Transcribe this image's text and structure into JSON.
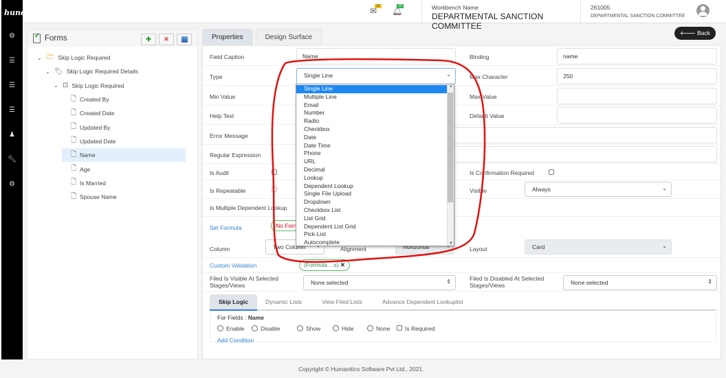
{
  "app": {
    "logo": "huno"
  },
  "sidebar": {
    "icons": [
      "cogs-icon",
      "database-icon",
      "database-icon",
      "database-icon",
      "users-icon",
      "wrench-icon",
      "cogs-icon"
    ]
  },
  "topbar": {
    "mail_count": "10",
    "notif_count": "10",
    "workbench_label": "Workbench Name",
    "workbench_name": "DEPARTMENTAL SANCTION COMMITTEE",
    "user_id": "261005",
    "user_dept": "DEPARTMENTAL SANCTION COMMITTEE"
  },
  "left_panel": {
    "title": "Forms",
    "tree": [
      {
        "label": "Skip Logic Required",
        "level": 0,
        "icon": "folder-open-icon",
        "expanded": true
      },
      {
        "label": "Skip Logic Required Details",
        "level": 1,
        "icon": "tag-icon",
        "expanded": true
      },
      {
        "label": "Skip Logic Required",
        "level": 2,
        "icon": "inbox-icon",
        "expanded": true
      },
      {
        "label": "Created By",
        "level": 3,
        "icon": "file-icon"
      },
      {
        "label": "Created Date",
        "level": 3,
        "icon": "file-icon"
      },
      {
        "label": "Updated By",
        "level": 3,
        "icon": "file-icon"
      },
      {
        "label": "Updated Date",
        "level": 3,
        "icon": "file-icon"
      },
      {
        "label": "Name",
        "level": 3,
        "icon": "file-icon",
        "selected": true
      },
      {
        "label": "Age",
        "level": 3,
        "icon": "file-icon"
      },
      {
        "label": "Is Married",
        "level": 3,
        "icon": "file-icon"
      },
      {
        "label": "Spouse Name",
        "level": 3,
        "icon": "file-icon"
      }
    ]
  },
  "main": {
    "tabs": [
      "Properties",
      "Design Surface"
    ],
    "back_label": "Back",
    "fields": {
      "field_caption": {
        "label": "Field Caption",
        "value": "Name"
      },
      "binding": {
        "label": "Binding",
        "value": "name"
      },
      "type": {
        "label": "Type",
        "value": "Single Line"
      },
      "max_character": {
        "label": "Max Character",
        "value": "250"
      },
      "min_value": {
        "label": "Min Value",
        "value": ""
      },
      "max_value": {
        "label": "Max Value",
        "value": ""
      },
      "help_text": {
        "label": "Help Text",
        "value": ""
      },
      "default_value": {
        "label": "Default Value",
        "value": ""
      },
      "error_message": {
        "label": "Error Message",
        "value": ""
      },
      "regular_expression": {
        "label": "Regular Expression",
        "value": ""
      },
      "is_audit": {
        "label": "Is Audit",
        "checked": false
      },
      "is_confirmation_required": {
        "label": "Is Confirmation Required",
        "checked": false
      },
      "is_repeatable": {
        "label": "Is Repeatable",
        "checked": false
      },
      "visible": {
        "label": "Visible",
        "value": "Always"
      },
      "is_multiple_dependent_lookup": {
        "label": "Is Multiple Dependent Lookup"
      },
      "set_formula": {
        "label": "Set Formula",
        "pill": "No Formula"
      },
      "column": {
        "label": "Column",
        "value": "Two Column"
      },
      "alignment": {
        "label": "Alignment",
        "value": "Horizontal"
      },
      "layout": {
        "label": "Layout",
        "value": "Card"
      },
      "custom_validation": {
        "label": "Custom Validation",
        "pill": "(Formula ...s)"
      },
      "visible_stages": {
        "label": "Filed Is Visible At Selected Stages/Views",
        "value": "None selected"
      },
      "disabled_stages": {
        "label": "Filed Is Disabled At Selected Stages/Views",
        "value": "None selected"
      }
    },
    "type_options": [
      "Single Line",
      "Multiple Line",
      "Email",
      "Number",
      "Radio",
      "Checkbox",
      "Date",
      "Date Time",
      "Phone",
      "URL",
      "Decimal",
      "Lookup",
      "Dependent Lookup",
      "Single File Upload",
      "Dropdown",
      "Checkbox List",
      "List Grid",
      "Dependent List Grid",
      "Pick-List",
      "Autocomplete"
    ],
    "sub_tabs": [
      "Skip Logic",
      "Dynamic Lists",
      "View Filed Lists",
      "Advance Dependent Lookuplist"
    ],
    "skip_logic": {
      "for_fields_label": "For Fields : ",
      "for_fields_value": "Name",
      "options": [
        "Enable",
        "Disable",
        "Show",
        "Hide",
        "None"
      ],
      "is_required_label": "Is Required",
      "add_condition": "Add Condition"
    }
  },
  "footer": {
    "copyright": "Copyright © Humanitics Software Pvt Ltd., 2021."
  },
  "colors": {
    "annotation": "#e01010",
    "highlight": "#1e88f0",
    "link": "#2f7fd6"
  }
}
